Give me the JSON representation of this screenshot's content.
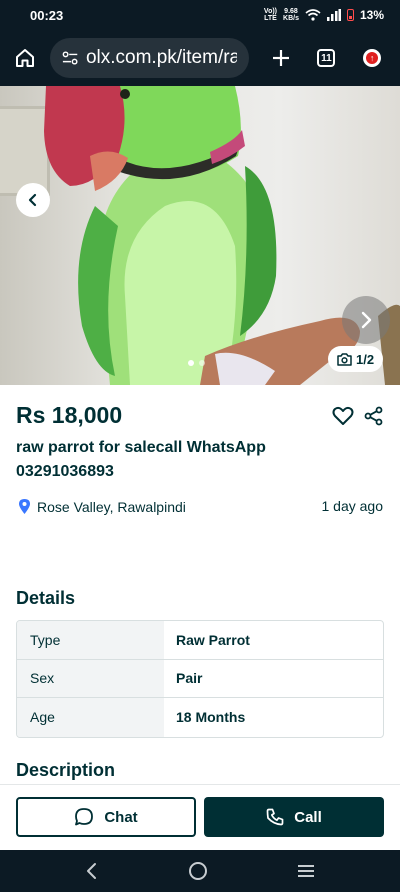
{
  "status": {
    "time": "00:23",
    "volte_top": "Vo))",
    "volte_bottom": "LTE",
    "speed_top": "9.68",
    "speed_bottom": "KB/s",
    "battery": "13%"
  },
  "browser": {
    "url": "olx.com.pk/item/raw",
    "tab_count": "11",
    "update_badge": "↑"
  },
  "gallery": {
    "counter": "1/2",
    "dot_count": 2,
    "active_dot": 1
  },
  "listing": {
    "price": "Rs 18,000",
    "title": "raw parrot for salecall WhatsApp 03291036893",
    "location": "Rose Valley, Rawalpindi",
    "posted": "1 day ago"
  },
  "details": {
    "heading": "Details",
    "rows": [
      {
        "key": "Type",
        "value": "Raw Parrot"
      },
      {
        "key": "Sex",
        "value": "Pair"
      },
      {
        "key": "Age",
        "value": "18 Months"
      }
    ]
  },
  "description": {
    "heading": "Description"
  },
  "actions": {
    "chat_label": "Chat",
    "call_label": "Call"
  },
  "colors": {
    "brand_dark": "#002f34",
    "system_bar": "#0c1a24",
    "location_pin": "#3a77ff"
  },
  "icons": [
    "home-icon",
    "site-settings-icon",
    "plus-icon",
    "tabs-icon",
    "update-icon",
    "chevron-left-icon",
    "chevron-right-icon",
    "camera-icon",
    "heart-icon",
    "share-icon",
    "location-pin-icon",
    "chat-bubble-icon",
    "phone-icon",
    "nav-back-icon",
    "nav-home-icon",
    "nav-recents-icon"
  ]
}
